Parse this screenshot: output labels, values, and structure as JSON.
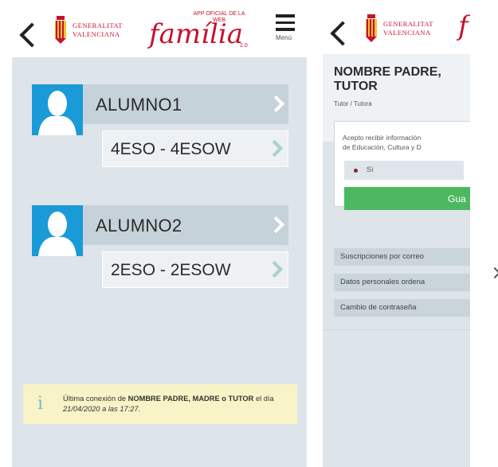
{
  "left_screen": {
    "header": {
      "brand_line1": "GENERALITAT",
      "brand_line2": "VALENCIANA",
      "app_sup_line1": "APP OFICIAL DE LA",
      "app_sup_line2": "WEB",
      "app_name": "família",
      "app_version": "2.0",
      "menu_label": "Menú"
    },
    "students": [
      {
        "name": "ALUMNO1",
        "course": "4ESO - 4ESOW"
      },
      {
        "name": "ALUMNO2",
        "course": "2ESO - 2ESOW"
      }
    ],
    "notice": {
      "icon": "i",
      "prefix": "Última conexión de ",
      "user": "NOMBRE PADRE, MADRE o TUTOR",
      "mid": " el día ",
      "date": "21/04/2020",
      "mid2": " a las ",
      "time": "17:27."
    }
  },
  "right_screen": {
    "header": {
      "brand_line1": "GENERALITAT",
      "brand_line2": "VALENCIANA",
      "app_name_partial": "f"
    },
    "parent_name_line1": "NOMBRE PADRE,",
    "parent_name_line2": "TUTOR",
    "role": "Tutor / Tutora",
    "consent_line1": "Acepto recibir información",
    "consent_line2": "de Educación, Cultura y D",
    "radio_label": "Sí",
    "save_label": "Gua",
    "menu": [
      {
        "label": "Suscripciones por correo"
      },
      {
        "label": "Datos personales ordena"
      },
      {
        "label": "Cambio de contraseña"
      }
    ]
  },
  "colors": {
    "brand_red": "#c8102e",
    "avatar_blue": "#1a9ad6",
    "save_green": "#4cb960",
    "notice_yellow": "#f8f4c7"
  },
  "icons": [
    "back-chevron-icon",
    "generalitat-shield-icon",
    "hamburger-menu-icon",
    "user-avatar-icon",
    "chevron-right-icon",
    "info-icon",
    "next-arrow-icon"
  ]
}
